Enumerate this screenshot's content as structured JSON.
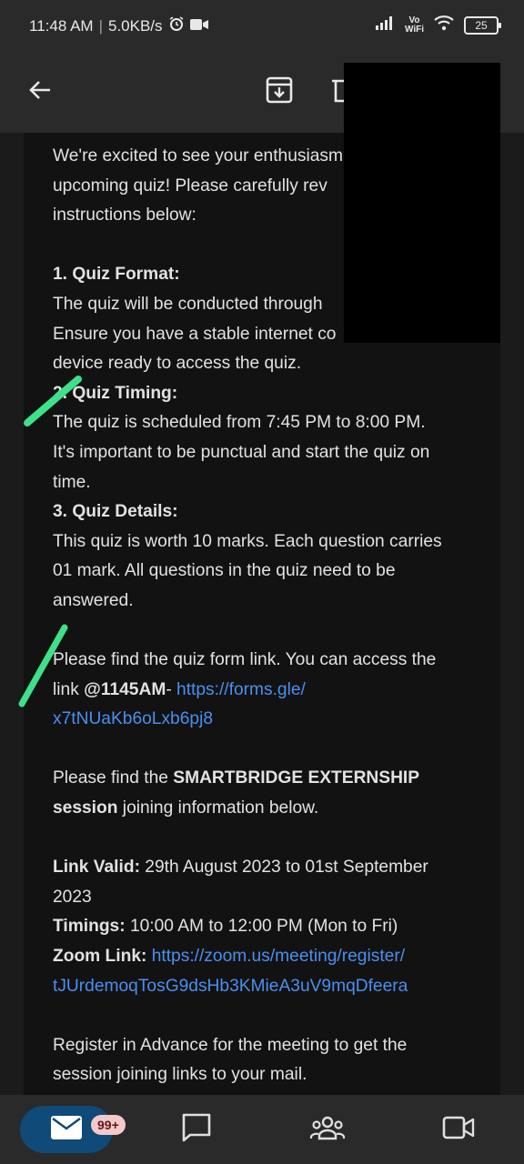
{
  "status": {
    "time": "11:48 AM",
    "speed": "5.0KB/s",
    "vowifi_top": "Vo",
    "vowifi_bottom": "WiFi",
    "battery": "25"
  },
  "toolbar": {
    "back_icon": "arrow-left-icon",
    "archive_icon": "archive-icon",
    "delete_icon": "trash-icon"
  },
  "email": {
    "intro_1": "We're excited to see your enthusiasm",
    "intro_2": "upcoming quiz! Please carefully rev",
    "intro_3": "instructions below:",
    "s1_title": "1. Quiz Format:",
    "s1_line1": "The quiz will be conducted through",
    "s1_line2": "Ensure you have a stable internet co",
    "s1_line3": "device ready to access the quiz.",
    "s2_title": "2. Quiz Timing:",
    "s2_line1": "The quiz is scheduled from 7:45 PM to 8:00 PM.",
    "s2_line2": "It's important to be punctual and start the quiz on",
    "s2_line3": "time.",
    "s3_title": "3. Quiz Details:",
    "s3_line1": "This quiz is worth 10 marks. Each question carries",
    "s3_line2": "01 mark. All questions in the quiz need to be",
    "s3_line3": "answered.",
    "form_line1": "Please find the quiz form link. You can access the",
    "form_pre": "link ",
    "form_time": "@1145AM",
    "form_dash": "- ",
    "form_link1": "https://forms.gle/",
    "form_link2": "x7tNUaKb6oLxb6pj8",
    "sb_pre": "Please find the ",
    "sb_bold1": "SMARTBRIDGE EXTERNSHIP",
    "sb_bold2": "session",
    "sb_post": " joining information below.",
    "valid_label": "Link Valid:",
    "valid_value": " 29th August 2023 to 01st September",
    "valid_value2": "2023",
    "timings_label": "Timings:",
    "timings_value": " 10:00 AM to 12:00 PM (Mon to Fri)",
    "zoom_label": "Zoom Link:",
    "zoom_link1": " https://zoom.us/meeting/register/",
    "zoom_link2": "tJUrdemoqTosG9dsHb3KMieA3uV9mqDfeera",
    "register_1": "Register in Advance for the meeting to get the",
    "register_2": "session joining links to your mail."
  },
  "bottom_nav": {
    "mail_icon": "mail-icon",
    "mail_badge": "99+",
    "chat_icon": "chat-icon",
    "spaces_icon": "people-icon",
    "meet_icon": "video-icon"
  },
  "colors": {
    "link": "#4a8ff0",
    "highlight_stroke": "#3ee08a",
    "nav_active": "#0f4a78"
  }
}
